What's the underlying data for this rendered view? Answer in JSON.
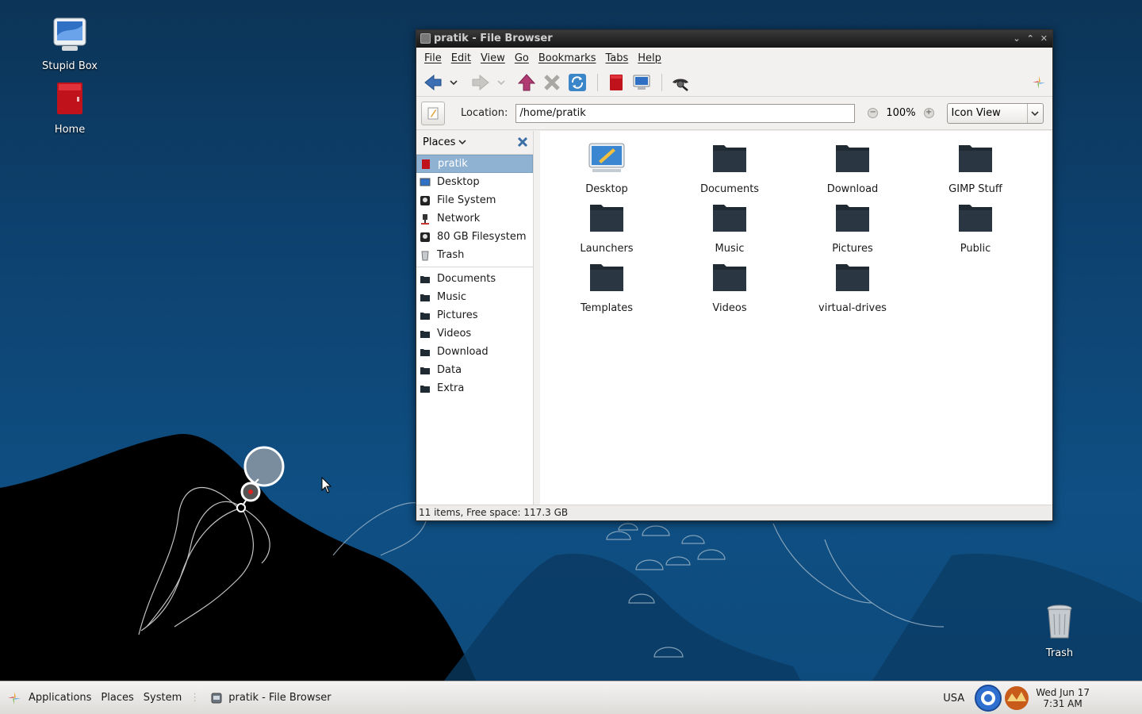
{
  "desktop": {
    "icons": [
      {
        "label": "Stupid Box"
      },
      {
        "label": "Home"
      },
      {
        "label": "Trash"
      }
    ]
  },
  "window": {
    "title": "pratik - File Browser",
    "menu": [
      "File",
      "Edit",
      "View",
      "Go",
      "Bookmarks",
      "Tabs",
      "Help"
    ],
    "location_label": "Location:",
    "location_value": "/home/pratik",
    "zoom_level": "100%",
    "view_mode": "Icon View",
    "sidebar": {
      "header": "Places",
      "places": [
        {
          "label": "pratik",
          "icon": "home-folder-icon",
          "selected": true
        },
        {
          "label": "Desktop",
          "icon": "desktop-icon"
        },
        {
          "label": "File System",
          "icon": "harddisk-icon"
        },
        {
          "label": "Network",
          "icon": "network-icon"
        },
        {
          "label": "80 GB Filesystem",
          "icon": "harddisk-icon"
        },
        {
          "label": "Trash",
          "icon": "trash-icon"
        }
      ],
      "bookmarks": [
        {
          "label": "Documents"
        },
        {
          "label": "Music"
        },
        {
          "label": "Pictures"
        },
        {
          "label": "Videos"
        },
        {
          "label": "Download"
        },
        {
          "label": "Data"
        },
        {
          "label": "Extra"
        }
      ]
    },
    "files": [
      {
        "label": "Desktop",
        "icon": "desktop-folder-icon"
      },
      {
        "label": "Documents",
        "icon": "folder-icon"
      },
      {
        "label": "Download",
        "icon": "folder-icon"
      },
      {
        "label": "GIMP Stuff",
        "icon": "folder-icon"
      },
      {
        "label": "Launchers",
        "icon": "folder-icon"
      },
      {
        "label": "Music",
        "icon": "folder-icon"
      },
      {
        "label": "Pictures",
        "icon": "folder-icon"
      },
      {
        "label": "Public",
        "icon": "folder-icon"
      },
      {
        "label": "Templates",
        "icon": "folder-icon"
      },
      {
        "label": "Videos",
        "icon": "folder-icon"
      },
      {
        "label": "virtual-drives",
        "icon": "folder-icon"
      }
    ],
    "status": "11 items, Free space: 117.3 GB"
  },
  "panel": {
    "menus": [
      "Applications",
      "Places",
      "System"
    ],
    "task": "pratik - File Browser",
    "keyboard_layout": "USA",
    "clock_date": "Wed Jun 17",
    "clock_time": "7:31 AM"
  },
  "colors": {
    "desktop_blue": "#0d4270",
    "selection": "#8fb2d3",
    "folder_dark": "#1f2a33"
  }
}
